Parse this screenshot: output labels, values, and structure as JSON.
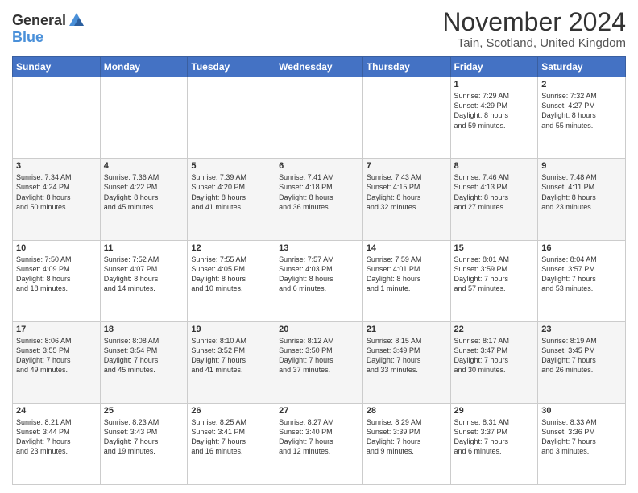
{
  "logo": {
    "general": "General",
    "blue": "Blue"
  },
  "header": {
    "month": "November 2024",
    "location": "Tain, Scotland, United Kingdom"
  },
  "weekdays": [
    "Sunday",
    "Monday",
    "Tuesday",
    "Wednesday",
    "Thursday",
    "Friday",
    "Saturday"
  ],
  "weeks": [
    [
      {
        "day": "",
        "info": ""
      },
      {
        "day": "",
        "info": ""
      },
      {
        "day": "",
        "info": ""
      },
      {
        "day": "",
        "info": ""
      },
      {
        "day": "",
        "info": ""
      },
      {
        "day": "1",
        "info": "Sunrise: 7:29 AM\nSunset: 4:29 PM\nDaylight: 8 hours\nand 59 minutes."
      },
      {
        "day": "2",
        "info": "Sunrise: 7:32 AM\nSunset: 4:27 PM\nDaylight: 8 hours\nand 55 minutes."
      }
    ],
    [
      {
        "day": "3",
        "info": "Sunrise: 7:34 AM\nSunset: 4:24 PM\nDaylight: 8 hours\nand 50 minutes."
      },
      {
        "day": "4",
        "info": "Sunrise: 7:36 AM\nSunset: 4:22 PM\nDaylight: 8 hours\nand 45 minutes."
      },
      {
        "day": "5",
        "info": "Sunrise: 7:39 AM\nSunset: 4:20 PM\nDaylight: 8 hours\nand 41 minutes."
      },
      {
        "day": "6",
        "info": "Sunrise: 7:41 AM\nSunset: 4:18 PM\nDaylight: 8 hours\nand 36 minutes."
      },
      {
        "day": "7",
        "info": "Sunrise: 7:43 AM\nSunset: 4:15 PM\nDaylight: 8 hours\nand 32 minutes."
      },
      {
        "day": "8",
        "info": "Sunrise: 7:46 AM\nSunset: 4:13 PM\nDaylight: 8 hours\nand 27 minutes."
      },
      {
        "day": "9",
        "info": "Sunrise: 7:48 AM\nSunset: 4:11 PM\nDaylight: 8 hours\nand 23 minutes."
      }
    ],
    [
      {
        "day": "10",
        "info": "Sunrise: 7:50 AM\nSunset: 4:09 PM\nDaylight: 8 hours\nand 18 minutes."
      },
      {
        "day": "11",
        "info": "Sunrise: 7:52 AM\nSunset: 4:07 PM\nDaylight: 8 hours\nand 14 minutes."
      },
      {
        "day": "12",
        "info": "Sunrise: 7:55 AM\nSunset: 4:05 PM\nDaylight: 8 hours\nand 10 minutes."
      },
      {
        "day": "13",
        "info": "Sunrise: 7:57 AM\nSunset: 4:03 PM\nDaylight: 8 hours\nand 6 minutes."
      },
      {
        "day": "14",
        "info": "Sunrise: 7:59 AM\nSunset: 4:01 PM\nDaylight: 8 hours\nand 1 minute."
      },
      {
        "day": "15",
        "info": "Sunrise: 8:01 AM\nSunset: 3:59 PM\nDaylight: 7 hours\nand 57 minutes."
      },
      {
        "day": "16",
        "info": "Sunrise: 8:04 AM\nSunset: 3:57 PM\nDaylight: 7 hours\nand 53 minutes."
      }
    ],
    [
      {
        "day": "17",
        "info": "Sunrise: 8:06 AM\nSunset: 3:55 PM\nDaylight: 7 hours\nand 49 minutes."
      },
      {
        "day": "18",
        "info": "Sunrise: 8:08 AM\nSunset: 3:54 PM\nDaylight: 7 hours\nand 45 minutes."
      },
      {
        "day": "19",
        "info": "Sunrise: 8:10 AM\nSunset: 3:52 PM\nDaylight: 7 hours\nand 41 minutes."
      },
      {
        "day": "20",
        "info": "Sunrise: 8:12 AM\nSunset: 3:50 PM\nDaylight: 7 hours\nand 37 minutes."
      },
      {
        "day": "21",
        "info": "Sunrise: 8:15 AM\nSunset: 3:49 PM\nDaylight: 7 hours\nand 33 minutes."
      },
      {
        "day": "22",
        "info": "Sunrise: 8:17 AM\nSunset: 3:47 PM\nDaylight: 7 hours\nand 30 minutes."
      },
      {
        "day": "23",
        "info": "Sunrise: 8:19 AM\nSunset: 3:45 PM\nDaylight: 7 hours\nand 26 minutes."
      }
    ],
    [
      {
        "day": "24",
        "info": "Sunrise: 8:21 AM\nSunset: 3:44 PM\nDaylight: 7 hours\nand 23 minutes."
      },
      {
        "day": "25",
        "info": "Sunrise: 8:23 AM\nSunset: 3:43 PM\nDaylight: 7 hours\nand 19 minutes."
      },
      {
        "day": "26",
        "info": "Sunrise: 8:25 AM\nSunset: 3:41 PM\nDaylight: 7 hours\nand 16 minutes."
      },
      {
        "day": "27",
        "info": "Sunrise: 8:27 AM\nSunset: 3:40 PM\nDaylight: 7 hours\nand 12 minutes."
      },
      {
        "day": "28",
        "info": "Sunrise: 8:29 AM\nSunset: 3:39 PM\nDaylight: 7 hours\nand 9 minutes."
      },
      {
        "day": "29",
        "info": "Sunrise: 8:31 AM\nSunset: 3:37 PM\nDaylight: 7 hours\nand 6 minutes."
      },
      {
        "day": "30",
        "info": "Sunrise: 8:33 AM\nSunset: 3:36 PM\nDaylight: 7 hours\nand 3 minutes."
      }
    ]
  ]
}
